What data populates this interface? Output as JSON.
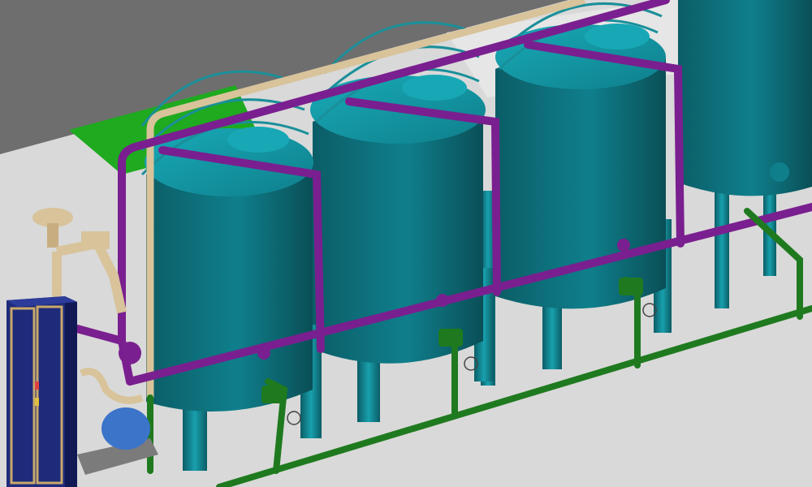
{
  "scene": {
    "tank_count": 4,
    "colors": {
      "background_dark": "#6e6e6e",
      "floor_light": "#d9d9d9",
      "ground_green": "#1faa1f",
      "tank_body": "#0f7f8c",
      "tank_top": "#159aa6",
      "tank_shadow": "#0b5d66",
      "support_leg": "#1a8f99",
      "railing": "#1a8f99",
      "purple_pipe": "#7a1f8f",
      "green_pipe": "#1f7a1f",
      "tan_pipe": "#d8c39b",
      "cabinet_body": "#1f2b7a",
      "pump_blue": "#3b74c9"
    }
  }
}
